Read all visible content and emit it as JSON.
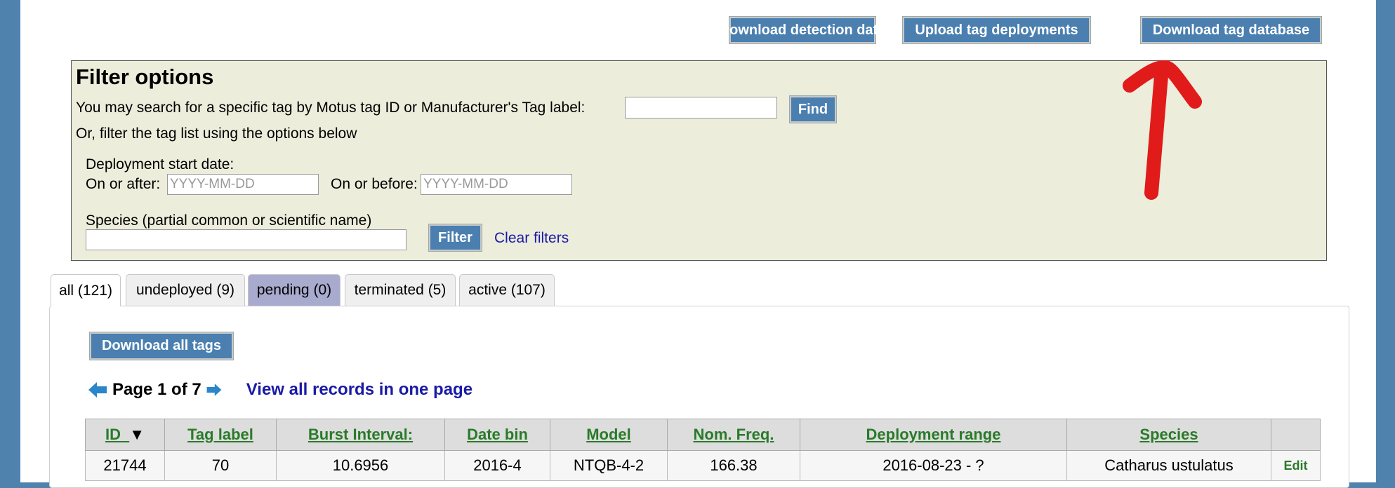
{
  "top_buttons": {
    "download_detection": "Download detection data",
    "upload_deployments": "Upload tag deployments",
    "download_database": "Download tag database"
  },
  "filter": {
    "title": "Filter options",
    "search_text": "You may search for a specific tag by Motus tag ID or Manufacturer's Tag label:",
    "find_label": "Find",
    "or_text": "Or, filter the tag list using the options below",
    "deploy_start_label": "Deployment start date:",
    "on_or_after_label": "On or after:",
    "on_or_before_label": "On or before:",
    "date_placeholder": "YYYY-MM-DD",
    "species_label": "Species (partial common or scientific name)",
    "filter_label": "Filter",
    "clear_label": "Clear filters"
  },
  "tabs": [
    {
      "label": "all (121)"
    },
    {
      "label": "undeployed (9)"
    },
    {
      "label": "pending (0)"
    },
    {
      "label": "terminated (5)"
    },
    {
      "label": "active (107)"
    }
  ],
  "download_all_label": "Download all tags",
  "pager": {
    "text": "Page 1 of 7",
    "view_all": "View all records in one page"
  },
  "table": {
    "columns": [
      "ID",
      "Tag label",
      "Burst Interval:",
      "Date bin",
      "Model",
      "Nom. Freq.",
      "Deployment range",
      "Species",
      ""
    ],
    "sort_indicator": "▼",
    "rows": [
      [
        "21744",
        "70",
        "10.6956",
        "2016-4",
        "NTQB-4-2",
        "166.38",
        "2016-08-23 - ?",
        "Catharus ustulatus",
        "Edit"
      ]
    ]
  },
  "colors": {
    "button_blue": "#4a7fb0",
    "filter_bg": "#ededdc",
    "link_blue": "#1a1aa6",
    "header_link_green": "#2a7a2a",
    "annotation_red": "#e11a1a"
  }
}
